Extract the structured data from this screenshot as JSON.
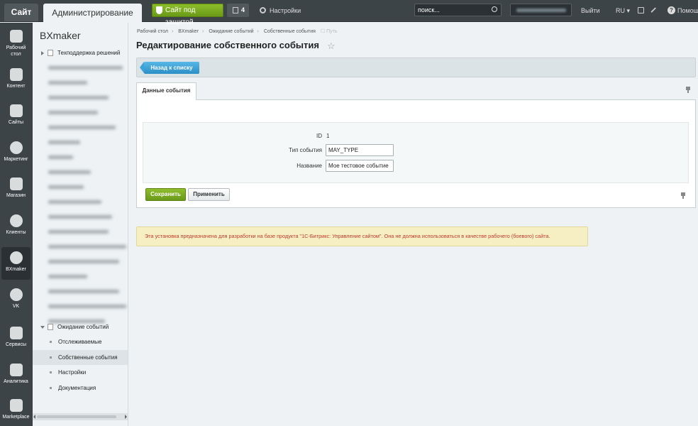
{
  "topbar": {
    "tab_site": "Сайт",
    "tab_admin": "Администрирование",
    "secure_label": "Сайт под защитой",
    "notifications_count": "4",
    "settings_label": "Настройки",
    "search_placeholder": "поиск...",
    "exit_label": "Выйти",
    "lang_label": "RU",
    "help_label": "Помощь"
  },
  "leftmenu": {
    "items": [
      {
        "label": "Рабочий стол",
        "icon": "home-icon"
      },
      {
        "label": "Контент",
        "icon": "document-icon"
      },
      {
        "label": "Сайты",
        "icon": "calendar-icon"
      },
      {
        "label": "Маркетинг",
        "icon": "target-icon"
      },
      {
        "label": "Магазин",
        "icon": "basket-icon"
      },
      {
        "label": "Клиенты",
        "icon": "clients-icon"
      },
      {
        "label": "BXmaker",
        "icon": "arrow-circle-icon"
      },
      {
        "label": "VK",
        "icon": "arrow-circle-icon"
      },
      {
        "label": "Сервисы",
        "icon": "layers-icon"
      },
      {
        "label": "Аналитика",
        "icon": "bar-chart-icon"
      },
      {
        "label": "Marketplace",
        "icon": "cloud-download-icon"
      }
    ]
  },
  "tree": {
    "title": "BXmaker",
    "first_item": "Техподдержка решений",
    "expanded_item": "Ожидание событий",
    "sub_items": [
      "Отслеживаемые",
      "Собственные события",
      "Настройки",
      "Документация"
    ]
  },
  "breadcrumbs": [
    "Рабочий стол",
    "BXmaker",
    "Ожидание событий",
    "Собственные события",
    "Путь"
  ],
  "page": {
    "title": "Редактирование собственного события",
    "back_button": "Назад к списку",
    "tab_label": "Данные события",
    "form": {
      "id_label": "ID",
      "id_value": "1",
      "type_label": "Тип события",
      "type_value": "MAY_TYPE",
      "name_label": "Название",
      "name_value": "Мое тестовое событие"
    },
    "save_button": "Сохранить",
    "apply_button": "Применить",
    "notice": "Эта установка предназначена для разработки на базе продукта \"1С-Битрикс: Управление сайтом\". Она не должна использоваться в качестве рабочего (боевого) сайта."
  }
}
